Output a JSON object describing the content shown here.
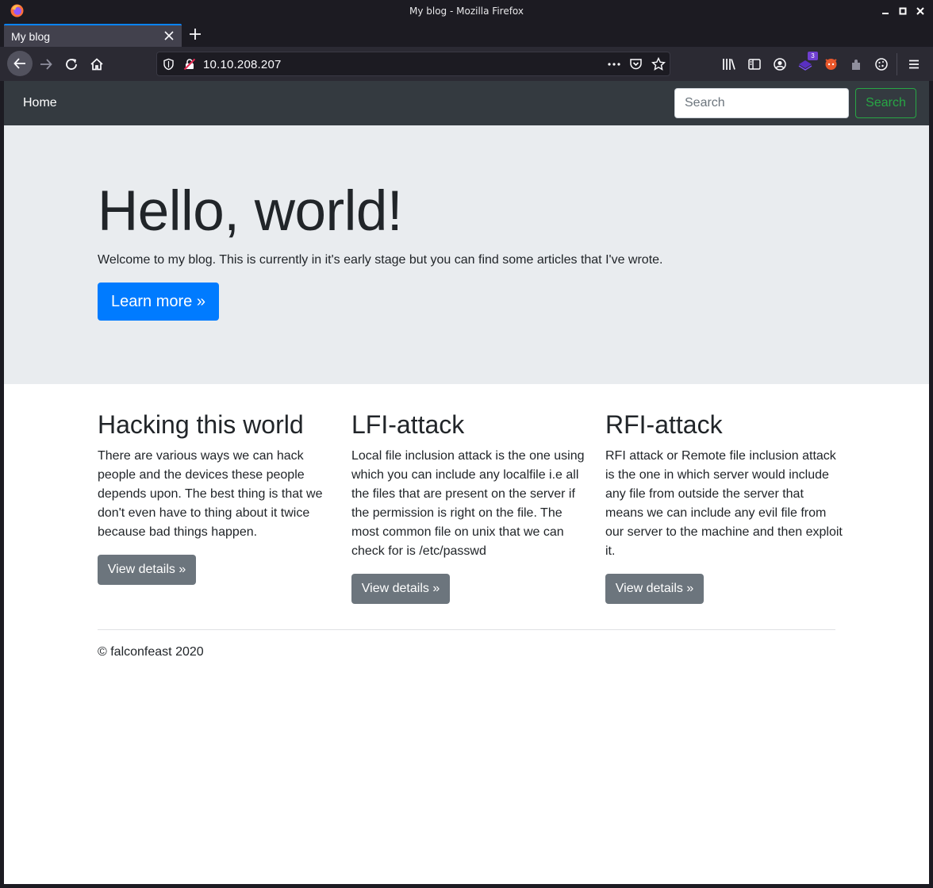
{
  "window": {
    "title": "My blog - Mozilla Firefox"
  },
  "tabs": [
    {
      "label": "My blog",
      "active": true
    }
  ],
  "toolbar": {
    "url": "10.10.208.207",
    "icons": [
      "back-arrow-icon",
      "forward-arrow-icon",
      "reload-icon",
      "home-icon",
      "shield-icon",
      "insecure-lock-icon",
      "more-dots-icon",
      "pocket-icon",
      "bookmark-star-icon",
      "library-icon",
      "sidebar-icon",
      "account-icon",
      "extension-icon",
      "foxyproxy-icon",
      "extension-puzzle-icon",
      "cookie-icon",
      "menu-icon"
    ],
    "extension_badge": "3"
  },
  "site": {
    "nav": {
      "home_label": "Home",
      "search_placeholder": "Search",
      "search_button": "Search"
    },
    "jumbotron": {
      "heading": "Hello, world!",
      "lead": "Welcome to my blog. This is currently in it's early stage but you can find some articles that I've wrote.",
      "button": "Learn more »"
    },
    "columns": [
      {
        "heading": "Hacking this world",
        "text": "There are various ways we can hack people and the devices these people depends upon. The best thing is that we don't even have to thing about it twice because bad things happen.",
        "button": "View details »"
      },
      {
        "heading": "LFI-attack",
        "text": "Local file inclusion attack is the one using which you can include any localfile i.e all the files that are present on the server if the permission is right on the file. The most common file on unix that we can check for is /etc/passwd",
        "button": "View details »"
      },
      {
        "heading": "RFI-attack",
        "text": "RFI attack or Remote file inclusion attack is the one in which server would include any file from outside the server that means we can include any evil file from our server to the machine and then exploit it.",
        "button": "View details »"
      }
    ],
    "footer": "© falconfeast 2020"
  },
  "colors": {
    "accent_tab": "#0a84ff",
    "navbar": "#343a40",
    "primary": "#007bff",
    "success": "#28a745",
    "secondary": "#6c757d",
    "jumbotron": "#e9ecef"
  }
}
